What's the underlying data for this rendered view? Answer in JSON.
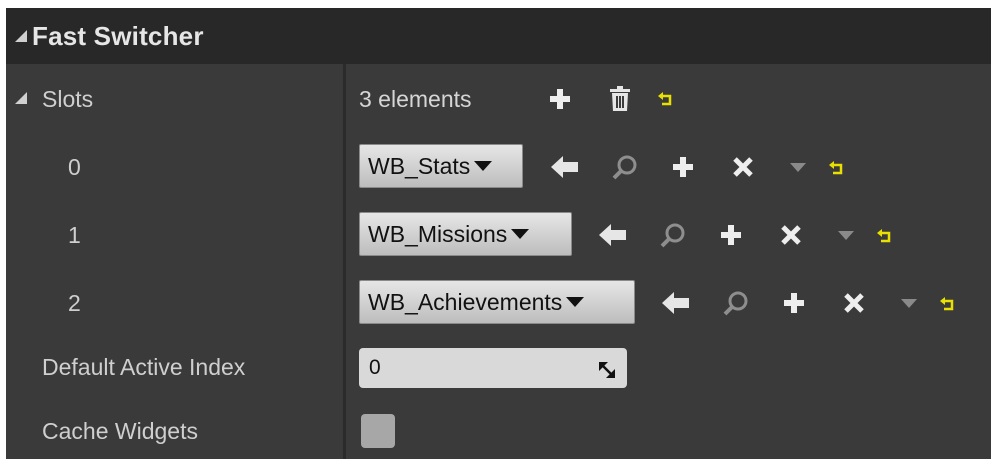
{
  "panel": {
    "title": "Fast Switcher"
  },
  "slots": {
    "label": "Slots",
    "count_text": "3 elements",
    "items": [
      {
        "index": "0",
        "value": "WB_Stats"
      },
      {
        "index": "1",
        "value": "WB_Missions"
      },
      {
        "index": "2",
        "value": "WB_Achievements"
      }
    ]
  },
  "default_active_index": {
    "label": "Default Active Index",
    "value": "0"
  },
  "cache_widgets": {
    "label": "Cache Widgets",
    "checked": false
  },
  "colors": {
    "panel_bg": "#3a3a3a",
    "header_bg": "#282828",
    "reset_arrow": "#e8e000",
    "text": "#cfcfcf"
  },
  "icons": {
    "expand": "expand-triangle-icon",
    "add": "plus-icon",
    "delete": "trash-icon",
    "reset": "reset-to-default-icon",
    "use_selected": "left-arrow-icon",
    "browse": "magnifier-icon",
    "clear": "x-icon",
    "menu": "dropdown-arrow-icon"
  }
}
